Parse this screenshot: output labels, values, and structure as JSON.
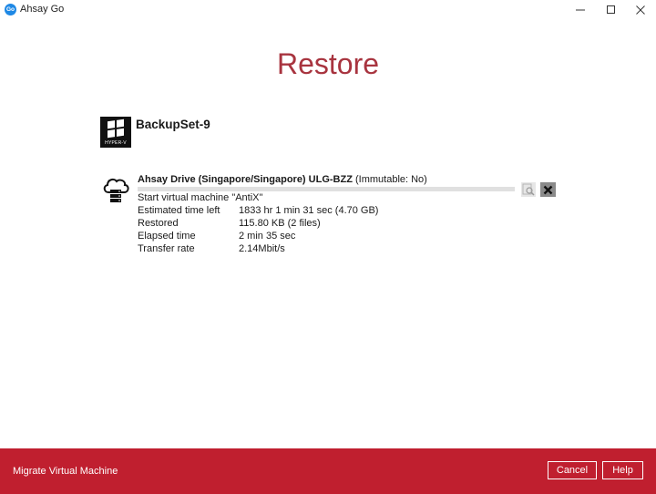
{
  "window": {
    "app_logo_text": "Go",
    "title": "Ahsay Go"
  },
  "page": {
    "title": "Restore"
  },
  "backupset": {
    "name": "BackupSet-9",
    "icon_label": "HYPER-V",
    "icon": "hyperv-windows-icon"
  },
  "destination": {
    "icon": "cloud-drive-icon",
    "name": "Ahsay Drive (Singapore/Singapore) ULG-BZZ",
    "immutable_text": "(Immutable: No)",
    "progress_fraction": 0.0
  },
  "status": {
    "line": "Start virtual machine \"AntiX\""
  },
  "stats": [
    {
      "label": "Estimated time left",
      "value": "1833 hr 1 min 31 sec (4.70 GB)"
    },
    {
      "label": "Restored",
      "value": "115.80 KB (2 files)"
    },
    {
      "label": "Elapsed time",
      "value": "2 min 35 sec"
    },
    {
      "label": "Transfer rate",
      "value": "2.14Mbit/s"
    }
  ],
  "footer": {
    "label": "Migrate Virtual Machine",
    "cancel_label": "Cancel",
    "help_label": "Help"
  },
  "colors": {
    "accent_title": "#a8343f",
    "footer_bg": "#c01f2f"
  }
}
